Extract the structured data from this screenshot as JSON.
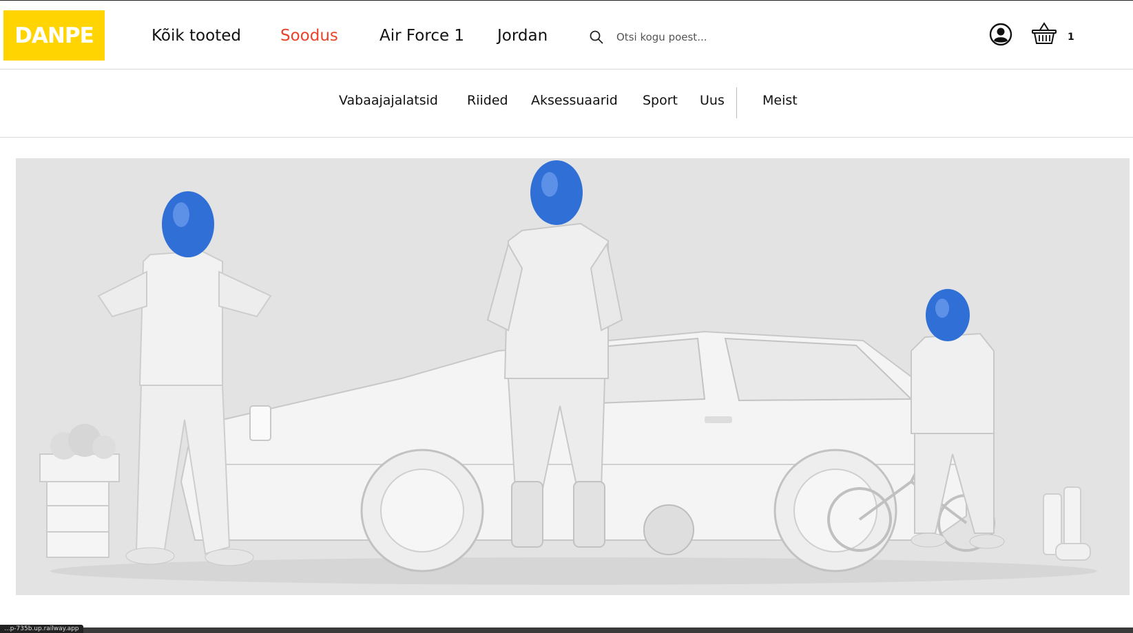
{
  "brand": {
    "logo_text": "DANPE",
    "logo_color": "#ffd400"
  },
  "main_nav": [
    {
      "label": "Kõik tooted"
    },
    {
      "label": "Soodus",
      "color": "#e8432b"
    },
    {
      "label": "Air Force 1"
    },
    {
      "label": "Jordan"
    }
  ],
  "search": {
    "placeholder": "Otsi kogu poest..."
  },
  "header_icons": {
    "account": "account-icon",
    "cart": "cart-icon",
    "search": "search-icon"
  },
  "cart": {
    "count": "1"
  },
  "sub_nav": [
    {
      "label": "Vabaajajalatsid"
    },
    {
      "label": "Riided"
    },
    {
      "label": "Aksessuaarid"
    },
    {
      "label": "Sport"
    },
    {
      "label": "Uus"
    },
    {
      "label": "Meist"
    }
  ],
  "hero": {
    "helmet_color": "#2f6fd6",
    "background": "#e3e3e3"
  },
  "status_bar": {
    "text": "...p-735b.up.railway.app"
  }
}
